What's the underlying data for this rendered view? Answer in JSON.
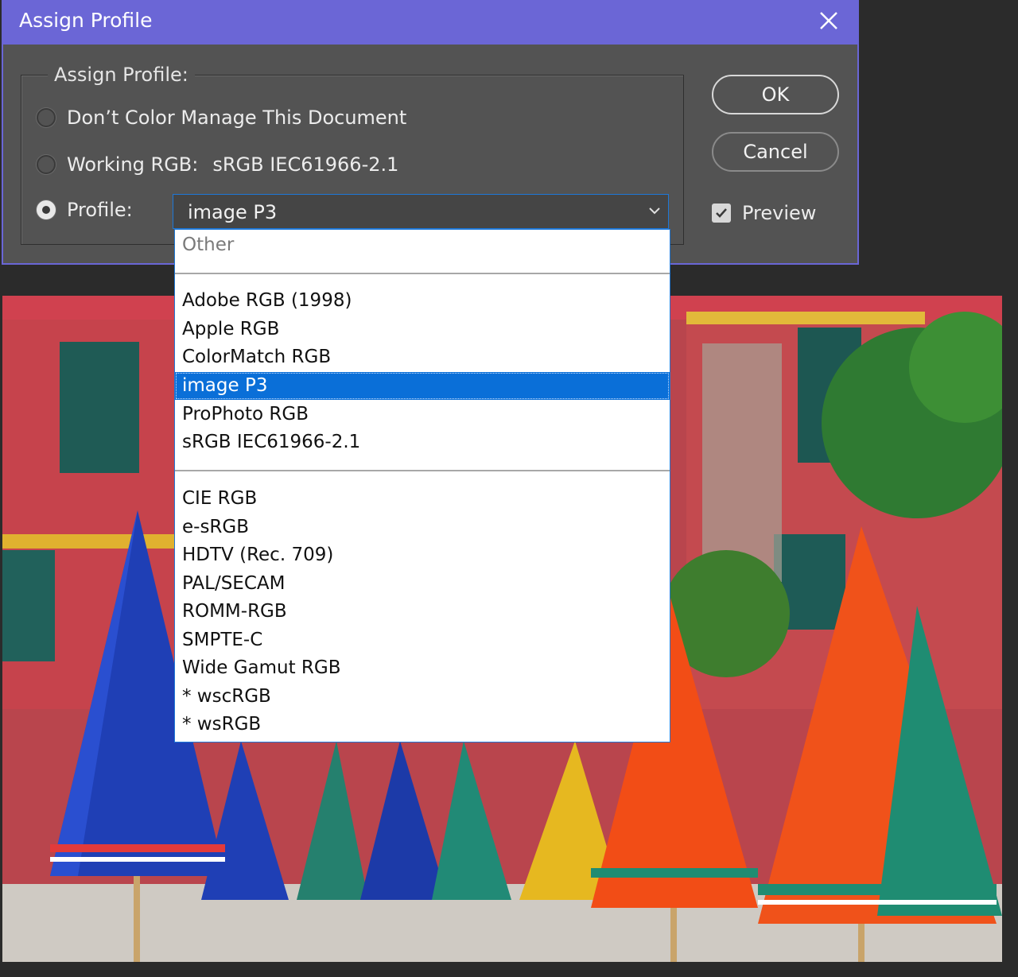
{
  "dialog": {
    "title": "Assign Profile",
    "group_label": "Assign Profile:",
    "options": {
      "dont_manage": "Don’t Color Manage This Document",
      "working_label": "Working RGB:",
      "working_value": "sRGB IEC61966-2.1",
      "profile_label": "Profile:"
    },
    "selected_option": "profile",
    "profile_select_value": "image P3",
    "ok_label": "OK",
    "cancel_label": "Cancel",
    "preview_label": "Preview",
    "preview_checked": true
  },
  "dropdown": {
    "header": "Other",
    "group1": [
      "Adobe RGB (1998)",
      "Apple RGB",
      "ColorMatch RGB",
      "image P3",
      "ProPhoto RGB",
      "sRGB IEC61966-2.1"
    ],
    "group2": [
      "CIE RGB",
      "e-sRGB",
      "HDTV (Rec. 709)",
      "PAL/SECAM",
      "ROMM-RGB",
      "SMPTE-C",
      "Wide Gamut RGB",
      "* wscRGB",
      "* wsRGB"
    ],
    "selected": "image P3"
  },
  "colors": {
    "titlebar": "#6b66d6",
    "dialog_bg": "#535353",
    "selection": "#0a6fd8"
  },
  "icons": {
    "close": "close-icon",
    "chevron": "chevron-down-icon",
    "check": "checkmark-icon"
  }
}
